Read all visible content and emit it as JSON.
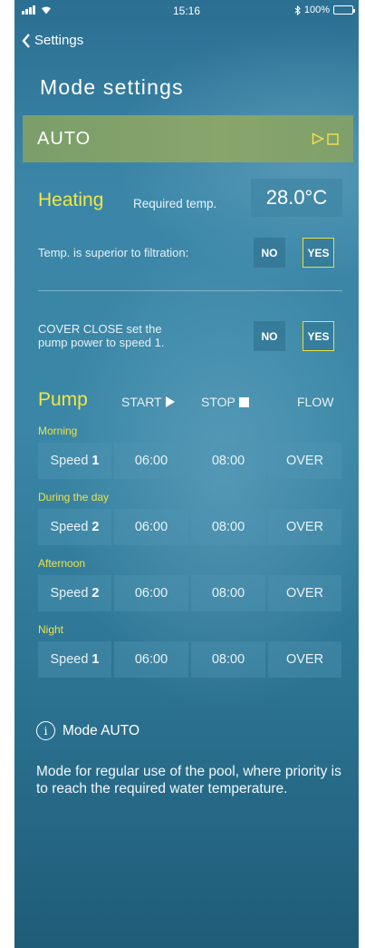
{
  "status_bar": {
    "time": "15:16",
    "battery": "100%"
  },
  "nav": {
    "back_label": "Settings"
  },
  "title": "Mode settings",
  "mode": {
    "name": "AUTO",
    "accent": "#f3e24a"
  },
  "heating": {
    "title": "Heating",
    "required_label": "Required temp.",
    "required_value": "28.0°C",
    "superior_label": "Temp. is superior to filtration:",
    "superior_no": "NO",
    "superior_yes": "YES",
    "superior_selected": "YES"
  },
  "cover": {
    "label_line1": "COVER CLOSE set the",
    "label_line2": "pump power to speed 1.",
    "no": "NO",
    "yes": "YES",
    "selected": "YES"
  },
  "pump": {
    "title": "Pump",
    "col_start": "START",
    "col_stop": "STOP",
    "col_flow": "FLOW",
    "speed_word": "Speed",
    "periods": [
      {
        "label": "Morning",
        "speed": "1",
        "start": "06:00",
        "stop": "08:00",
        "flow": "OVER"
      },
      {
        "label": "During the day",
        "speed": "2",
        "start": "06:00",
        "stop": "08:00",
        "flow": "OVER"
      },
      {
        "label": "Afternoon",
        "speed": "2",
        "start": "06:00",
        "stop": "08:00",
        "flow": "OVER"
      },
      {
        "label": "Night",
        "speed": "1",
        "start": "06:00",
        "stop": "08:00",
        "flow": "OVER"
      }
    ]
  },
  "info": {
    "title": "Mode AUTO",
    "description": "Mode for regular use of the pool, where priority is to reach the required water temperature."
  }
}
